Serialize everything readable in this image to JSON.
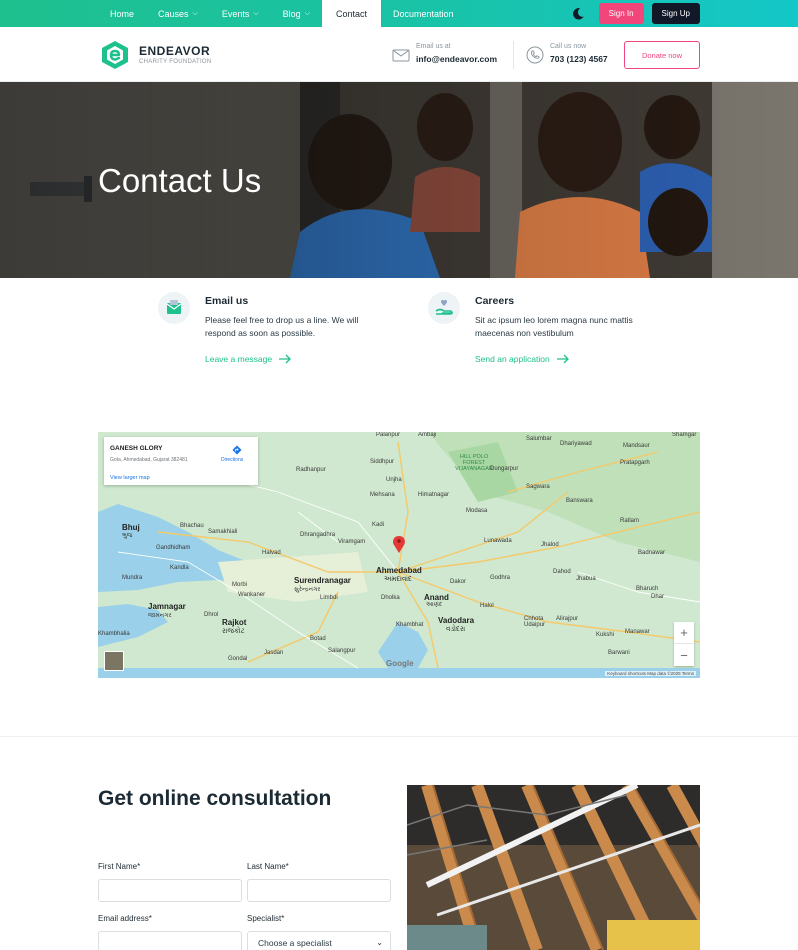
{
  "nav": {
    "items": [
      {
        "label": "Home",
        "has_dropdown": false,
        "active": false
      },
      {
        "label": "Causes",
        "has_dropdown": true,
        "active": false
      },
      {
        "label": "Events",
        "has_dropdown": true,
        "active": false
      },
      {
        "label": "Blog",
        "has_dropdown": true,
        "active": false
      },
      {
        "label": "Contact",
        "has_dropdown": false,
        "active": true
      },
      {
        "label": "Documentation",
        "has_dropdown": false,
        "active": false
      }
    ],
    "theme_icon": "moon-icon",
    "signin_label": "Sign In",
    "signup_label": "Sign Up"
  },
  "brand": {
    "name": "ENDEAVOR",
    "tagline": "CHARITY FOUNDATION",
    "logo_icon": "endeavor-logo-icon",
    "email_label": "Email us at",
    "email_value": "info@endeavor.com",
    "phone_label": "Call us now",
    "phone_value": "703 (123) 4567",
    "donate_label": "Donate now"
  },
  "hero": {
    "title": "Contact Us"
  },
  "info_cards": [
    {
      "icon": "envelope-icon",
      "title": "Email us",
      "text": "Please feel free to drop us a line. We will respond as soon as possible.",
      "link": "Leave a message"
    },
    {
      "icon": "hand-heart-icon",
      "title": "Careers",
      "text": "Sit ac ipsum leo lorem magna nunc mattis maecenas non vestibulum",
      "link": "Send an application"
    }
  ],
  "map": {
    "card_title": "GANESH GLORY",
    "card_address": "Gota, Ahmedabad, Gujarat 382481",
    "card_link": "View larger map",
    "directions_label": "Directions",
    "zoom_in": "+",
    "zoom_out": "−",
    "google": "Google",
    "footer": "Keyboard shortcuts   Map data ©2025   Terms",
    "places": {
      "bhuj": "Bhuj",
      "bhuj_gu": "ભુજ",
      "ahmedabad": "Ahmedabad",
      "ahmedabad_gu": "અમદાવાદ",
      "rajkot": "Rajkot",
      "rajkot_gu": "રાજકોટ",
      "vadodara": "Vadodara",
      "vadodara_gu": "વડોદરા",
      "surendranagar": "Surendranagar",
      "surendranagar_gu": "સુરેન્દ્રનગર",
      "jamnagar": "Jamnagar",
      "jamnagar_gu": "જામનગર",
      "anand": "Anand",
      "anand_gu": "આણંદ",
      "forest": "HILL POLO FOREST VIJAYANAGAR",
      "palanpur": "Palanpur",
      "ambaji": "Ambaji",
      "salumbar": "Salumbar",
      "dhariyawad": "Dhariyawad",
      "siddhpur": "Siddhpur",
      "unjha": "Unjha",
      "mehsana": "Mehsana",
      "radhanpur": "Radhanpur",
      "himatnagar": "Himatnagar",
      "modasa": "Modasa",
      "dungarpur": "Dungarpur",
      "sagwara": "Sagwara",
      "banswara": "Banswara",
      "ratlam": "Ratlam",
      "pratapgarh": "Pratapgarh",
      "mandsaur": "Mandsaur",
      "bhachau": "Bhachau",
      "gandhidham": "Gandhidham",
      "samakhiali": "Samakhiali",
      "kandla": "Kandla",
      "mundra": "Mundra",
      "halvad": "Halvad",
      "dhrangadhra": "Dhrangadhra",
      "viramgam": "Viramgam",
      "kadi": "Kadi",
      "lunawada": "Lunawada",
      "jhalod": "Jhalod",
      "dahod": "Dahod",
      "godhra": "Godhra",
      "jhabua": "Jhabua",
      "badnawar": "Badnawar",
      "dhar": "Dhar",
      "morbi": "Morbi",
      "wankaner": "Wankaner",
      "limbdi": "Limbdi",
      "dholka": "Dholka",
      "dakor": "Dakor",
      "halol": "Halol",
      "chhota_udaipur": "Chhota Udaipur",
      "alirajpur": "Alirajpur",
      "kukshi": "Kukshi",
      "manawar": "Manawar",
      "barwani": "Barwani",
      "khambhat": "Khambhat",
      "botad": "Botad",
      "gondal": "Gondal",
      "jasdan": "Jasdan",
      "salangpur": "Salangpur",
      "khambhalia": "Khambhalia",
      "dhrol": "Dhrol",
      "shamgar": "Shamgar",
      "bharuch": "Bharuch"
    }
  },
  "form": {
    "title": "Get online consultation",
    "first_name_label": "First Name*",
    "last_name_label": "Last Name*",
    "email_label": "Email address*",
    "specialist_label": "Specialist*",
    "specialist_value": "Choose a specialist"
  },
  "colors": {
    "accent_green": "#1ec08e",
    "accent_pink": "#f2467a",
    "dark": "#111827"
  }
}
